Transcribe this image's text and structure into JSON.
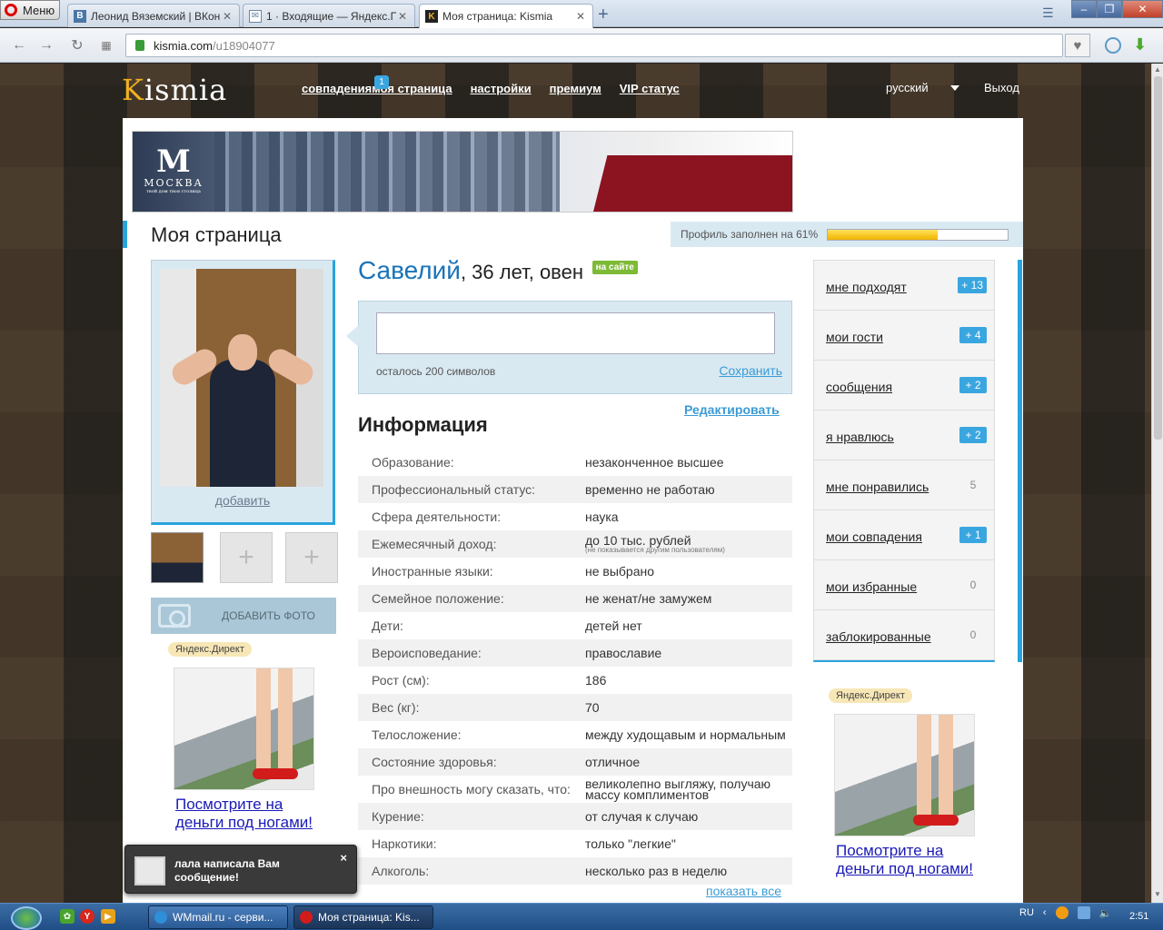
{
  "browser": {
    "menu_label": "Меню",
    "tabs": [
      {
        "title": "Леонид Вяземский | ВКон",
        "favicon": "vk-icon"
      },
      {
        "title": "1 · Входящие — Яндекс.П",
        "favicon": "mail-icon"
      },
      {
        "title": "Моя страница: Kismia",
        "favicon": "kismia-icon"
      }
    ],
    "url_host": "kismia.com",
    "url_path": "/u18904077"
  },
  "site": {
    "logo": "Kismia",
    "nav": [
      {
        "label": "совпадения"
      },
      {
        "label": "моя страница"
      },
      {
        "label": "настройки"
      },
      {
        "label": "премиум"
      },
      {
        "label": "VIP статус"
      }
    ],
    "nav_badge": "1",
    "language": "русский",
    "logout": "Выход"
  },
  "banner": {
    "brand": "МОСКВА",
    "tagline": "твой дом твоя столица"
  },
  "page": {
    "title": "Моя страница",
    "profile_fill_text": "Профиль заполнен на 61%",
    "profile_fill_percent": 61
  },
  "profile": {
    "name": "Савелий",
    "details": ", 36 лет, овен",
    "online_badge": "на сайте",
    "add_photo_link": "добавить",
    "add_photo_button": "ДОБАВИТЬ ФОТО"
  },
  "status": {
    "chars_left": "осталось 200 символов",
    "save": "Сохранить",
    "edit": "Редактировать"
  },
  "info": {
    "title": "Информация",
    "rows": [
      {
        "label": "Образование:",
        "value": "незаконченное высшее"
      },
      {
        "label": "Профессиональный статус:",
        "value": "временно не работаю"
      },
      {
        "label": "Сфера деятельности:",
        "value": "наука"
      },
      {
        "label": "Ежемесячный доход:",
        "value": "до 10 тыс. рублей",
        "note": "(не показывается другим пользователям)"
      },
      {
        "label": "Иностранные языки:",
        "value": "не выбрано"
      },
      {
        "label": "Семейное положение:",
        "value": "не женат/не замужем"
      },
      {
        "label": "Дети:",
        "value": "детей нет"
      },
      {
        "label": "Вероисповедание:",
        "value": "православие"
      },
      {
        "label": "Рост (см):",
        "value": "186"
      },
      {
        "label": "Вес (кг):",
        "value": "70"
      },
      {
        "label": "Телосложение:",
        "value": "между худощавым и нормальным"
      },
      {
        "label": "Состояние здоровья:",
        "value": "отличное"
      },
      {
        "label": "Про внешность могу сказать, что:",
        "value": "великолепно выгляжу, получаю массу комплиментов"
      },
      {
        "label": "Курение:",
        "value": "от случая к случаю"
      },
      {
        "label": "Наркотики:",
        "value": "только \"легкие\""
      },
      {
        "label": "Алкоголь:",
        "value": "несколько раз в неделю"
      }
    ],
    "show_all": "показать все"
  },
  "sidebar": {
    "items": [
      {
        "label": "мне подходят",
        "count": "+ 13",
        "highlight": true
      },
      {
        "label": "мои гости",
        "count": "+ 4",
        "highlight": true
      },
      {
        "label": "сообщения",
        "count": "+ 2",
        "highlight": true
      },
      {
        "label": "я нравлюсь",
        "count": "+ 2",
        "highlight": true
      },
      {
        "label": "мне понравились",
        "count": "5",
        "highlight": false
      },
      {
        "label": "мои совпадения",
        "count": "+ 1",
        "highlight": true
      },
      {
        "label": "мои избранные",
        "count": "0",
        "highlight": false
      },
      {
        "label": "заблокированные",
        "count": "0",
        "highlight": false
      }
    ]
  },
  "ads": {
    "label": "Яндекс.Директ",
    "headline": "Посмотрите на деньги под ногами!"
  },
  "notification": {
    "text": "лала написала Вам сообщение!",
    "close": "×"
  },
  "taskbar": {
    "tasks": [
      {
        "title": "WMmail.ru - серви..."
      },
      {
        "title": "Моя страница: Kis..."
      }
    ],
    "lang": "RU",
    "time": "2:51"
  },
  "colors": {
    "accent": "#29a3dd",
    "name": "#1a73b8",
    "online": "#7dba35",
    "link": "#3a9bd5"
  }
}
